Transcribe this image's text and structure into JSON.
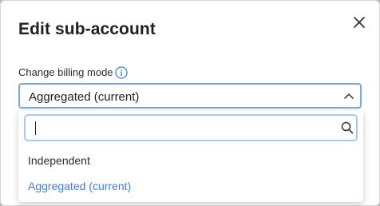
{
  "modal": {
    "title": "Edit sub-account"
  },
  "field": {
    "label": "Change billing mode",
    "selected_value": "Aggregated (current)",
    "search_placeholder": "",
    "options": [
      {
        "label": "Independent",
        "selected": false
      },
      {
        "label": "Aggregated (current)",
        "selected": true
      }
    ]
  },
  "icons": {
    "close": "close-icon",
    "info": "info-icon",
    "chevron": "chevron-up-icon",
    "search": "search-icon"
  },
  "colors": {
    "accent": "#3d7fe0",
    "focus_border": "#7aa9e8",
    "backdrop": "#b9b9b9"
  }
}
